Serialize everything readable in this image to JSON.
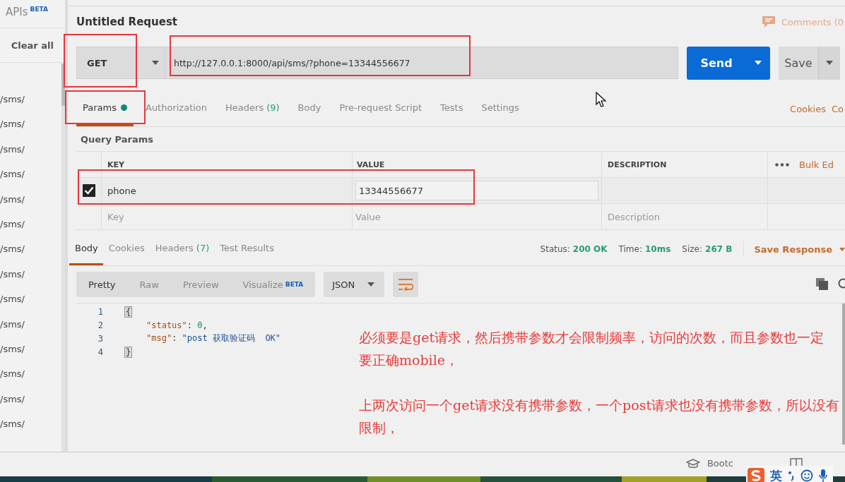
{
  "sidebar": {
    "apis_label": "APIs",
    "apis_badge": "BETA",
    "clear_all": "Clear all",
    "history": [
      "/sms/",
      "/sms/",
      "/sms/",
      "/sms/",
      "/sms/",
      "/sms/",
      "/sms/",
      "/sms/",
      "/sms/",
      "/sms/",
      "/sms/",
      "/sms/",
      "/sms/",
      "/sms/"
    ]
  },
  "request": {
    "title": "Untitled Request",
    "comments": "Comments (0",
    "method": "GET",
    "url": "http://127.0.0.1:8000/api/sms/?phone=13344556677",
    "send": "Send",
    "save": "Save"
  },
  "request_tabs": [
    {
      "label": "Params",
      "dot": true,
      "selected": true
    },
    {
      "label": "Authorization",
      "dot": false,
      "selected": false
    },
    {
      "label": "Headers",
      "count": "(9)",
      "dot": false,
      "selected": false
    },
    {
      "label": "Body",
      "dot": false,
      "selected": false
    },
    {
      "label": "Pre-request Script",
      "dot": false,
      "selected": false
    },
    {
      "label": "Tests",
      "dot": false,
      "selected": false
    },
    {
      "label": "Settings",
      "dot": false,
      "selected": false
    }
  ],
  "request_links": [
    "Cookies",
    "Co"
  ],
  "params": {
    "title": "Query Params",
    "columns": [
      "KEY",
      "VALUE",
      "DESCRIPTION"
    ],
    "bulk_edit": "Bulk Ed",
    "rows": [
      {
        "checked": true,
        "key": "phone",
        "value": "13344556677"
      }
    ],
    "new_row": {
      "key_placeholder": "Key",
      "value_placeholder": "Value",
      "description_placeholder": "Description"
    }
  },
  "response_tabs": [
    {
      "label": "Body",
      "selected": true
    },
    {
      "label": "Cookies",
      "selected": false
    },
    {
      "label": "Headers",
      "count": "(7)",
      "selected": false
    },
    {
      "label": "Test Results",
      "selected": false
    }
  ],
  "response_meta": [
    {
      "label": "Status:",
      "value": "200 OK"
    },
    {
      "label": "Time:",
      "value": "10ms"
    },
    {
      "label": "Size:",
      "value": "267 B"
    }
  ],
  "save_response": "Save Response",
  "view_modes": [
    {
      "label": "Pretty",
      "selected": true
    },
    {
      "label": "Raw",
      "selected": false
    },
    {
      "label": "Preview",
      "selected": false
    },
    {
      "label": "Visualize",
      "badge": "BETA",
      "selected": false
    }
  ],
  "format": "JSON",
  "code_lines": [
    {
      "number": "1",
      "tokens": [
        {
          "kind": "brace",
          "text": "{"
        }
      ]
    },
    {
      "number": "2",
      "tokens": [
        {
          "kind": "key",
          "text": "\"status\""
        },
        {
          "kind": "punct",
          "text": ": "
        },
        {
          "kind": "number",
          "text": "0"
        },
        {
          "kind": "punct",
          "text": ","
        }
      ]
    },
    {
      "number": "3",
      "tokens": [
        {
          "kind": "key",
          "text": "\"msg\""
        },
        {
          "kind": "punct",
          "text": ": "
        },
        {
          "kind": "string",
          "text": "\"post 获取验证码  OK\""
        }
      ]
    },
    {
      "number": "4",
      "tokens": [
        {
          "kind": "brace",
          "text": "}"
        }
      ]
    }
  ],
  "annotation": {
    "paragraphs": [
      "必须要是get请求，然后携带参数才会限制频率，访问的次数，而且参数也一定要正确mobile，",
      "上两次访问一个get请求没有携带参数，一个post请求也没有携带参数，所以没有限制，"
    ]
  },
  "status_bar": {
    "bootcamp": "Bootc"
  },
  "ime": {
    "mode": "英"
  }
}
